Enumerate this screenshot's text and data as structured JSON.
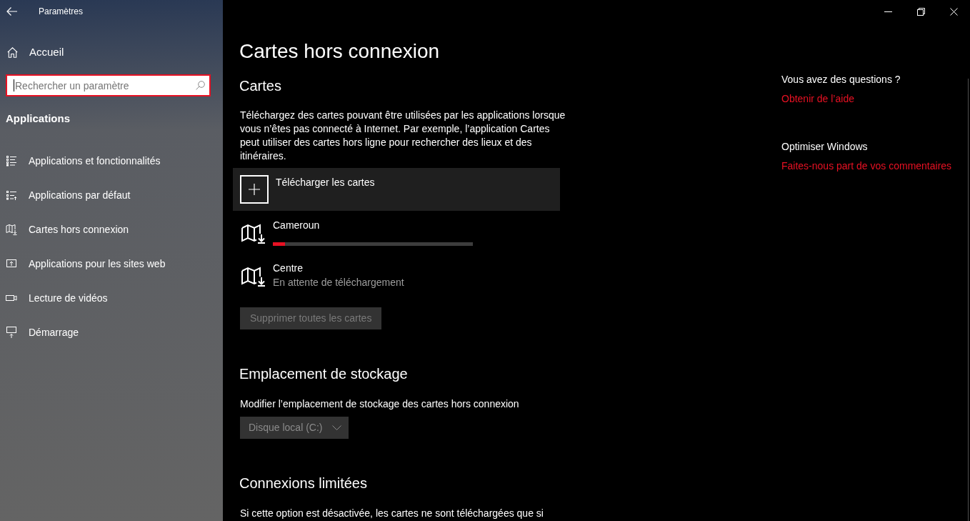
{
  "window": {
    "title": "Paramètres"
  },
  "sidebar": {
    "home": "Accueil",
    "search": {
      "placeholder": "Rechercher un paramètre",
      "focused": true
    },
    "section": "Applications",
    "items": [
      {
        "label": "Applications et fonctionnalités"
      },
      {
        "label": "Applications par défaut"
      },
      {
        "label": "Cartes hors connexion"
      },
      {
        "label": "Applications pour les sites web"
      },
      {
        "label": "Lecture de vidéos"
      },
      {
        "label": "Démarrage"
      }
    ]
  },
  "page": {
    "title": "Cartes hors connexion",
    "maps": {
      "heading": "Cartes",
      "description": "Téléchargez des cartes pouvant être utilisées par les applications lorsque vous n’êtes pas connecté à Internet. Par exemple, l’application Cartes peut utiliser des cartes hors ligne pour rechercher des lieux et des itinéraires.",
      "download_button": "Télécharger les cartes",
      "items": [
        {
          "kind": "progress",
          "name": "Cameroun",
          "level": 0.06
        },
        {
          "kind": "status",
          "name": "Centre",
          "status": "En attente de téléchargement"
        }
      ],
      "delete_button": {
        "label": "Supprimer toutes les cartes",
        "disabled": true
      }
    },
    "storage": {
      "heading": "Emplacement de stockage",
      "label": "Modifier l’emplacement de stockage des cartes hors connexion",
      "dropdown": {
        "value": "Disque local (C:)",
        "disabled": true
      }
    },
    "metered": {
      "heading": "Connexions limitées",
      "description": "Si cette option est désactivée, les cartes ne sont téléchargées que si"
    }
  },
  "help": [
    {
      "heading": "Vous avez des questions ?",
      "link": "Obtenir de l’aide"
    },
    {
      "heading": "Optimiser Windows",
      "link": "Faites-nous part de vos commentaires"
    }
  ]
}
